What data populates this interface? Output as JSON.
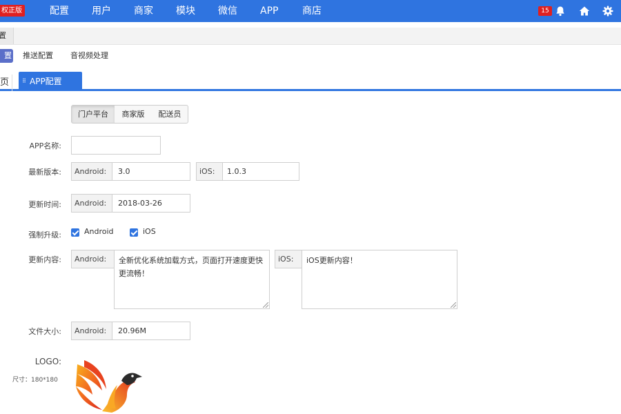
{
  "header": {
    "brand_label": "权正版",
    "nav": [
      "配置",
      "用户",
      "商家",
      "模块",
      "微信",
      "APP",
      "商店"
    ],
    "notification_count": "15",
    "colors": {
      "primary": "#2f74e0",
      "badge": "#e02020"
    },
    "icons": [
      "bell-icon",
      "home-icon",
      "gear-icon"
    ]
  },
  "menu": {
    "level1_item": "置",
    "sub_tabs": [
      "置",
      "推送配置",
      "音视频处理"
    ]
  },
  "page_tabs": {
    "home": "页",
    "active": "APP配置",
    "close": "×",
    "grip": "⠿"
  },
  "platforms": [
    "门户平台",
    "商家版",
    "配送员"
  ],
  "form": {
    "app_name": {
      "label": "APP名称:",
      "value": ""
    },
    "latest_version": {
      "label": "最新版本:",
      "android_addon": "Android:",
      "android_value": "3.0",
      "ios_addon": "iOS:",
      "ios_value": "1.0.3"
    },
    "update_time": {
      "label": "更新时间:",
      "addon": "Android:",
      "value": "2018-03-26"
    },
    "force_upgrade": {
      "label": "强制升级:",
      "android": "Android",
      "ios": "iOS",
      "android_checked": true,
      "ios_checked": true
    },
    "update_content": {
      "label": "更新内容:",
      "android_addon": "Android:",
      "android_text": "全新优化系统加载方式，页面打开速度更快更流畅！",
      "ios_addon": "iOS:",
      "ios_text": "iOS更新内容！"
    },
    "file_size": {
      "label": "文件大小:",
      "addon": "Android:",
      "value": "20.96M"
    },
    "logo": {
      "label": "LOGO:",
      "size_hint": "尺寸：180*180"
    }
  }
}
